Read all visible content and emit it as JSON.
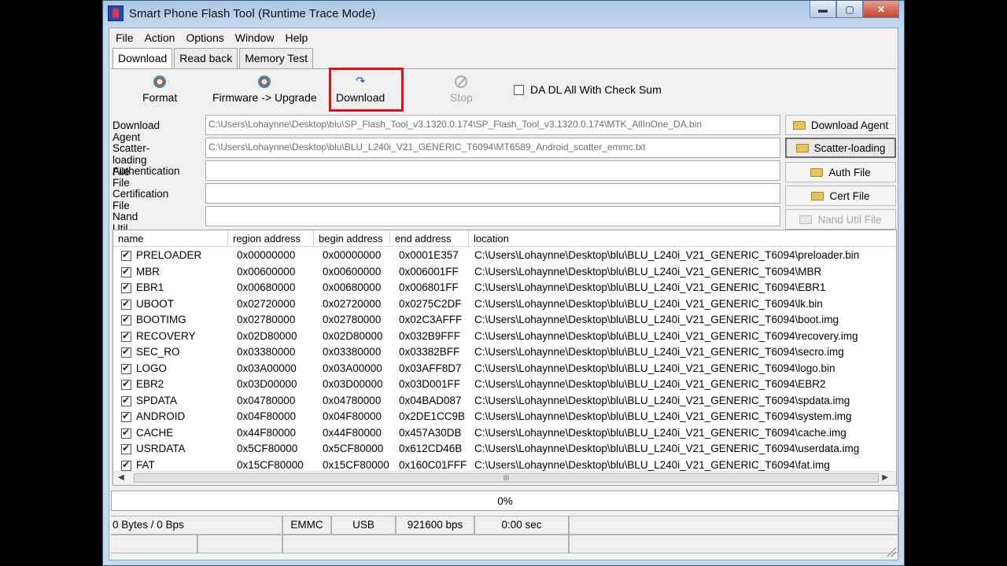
{
  "window": {
    "title": "Smart Phone Flash Tool (Runtime Trace Mode)",
    "min": "▬",
    "max": "▢",
    "close": "✕"
  },
  "menu": [
    "File",
    "Action",
    "Options",
    "Window",
    "Help"
  ],
  "tabs": [
    "Download",
    "Read back",
    "Memory Test"
  ],
  "toolbar": {
    "format": "Format",
    "firmware": "Firmware -> Upgrade",
    "download": "Download",
    "stop": "Stop",
    "checksum": "DA DL All With Check Sum"
  },
  "fields": {
    "download_agent": {
      "label": "Download Agent",
      "value": "C:\\Users\\Lohaynne\\Desktop\\blu\\SP_Flash_Tool_v3.1320.0.174\\SP_Flash_Tool_v3.1320.0.174\\MTK_AllInOne_DA.bin",
      "button": "Download Agent"
    },
    "scatter": {
      "label": "Scatter-loading File",
      "value": "C:\\Users\\Lohaynne\\Desktop\\blu\\BLU_L240i_V21_GENERIC_T6094\\MT6589_Android_scatter_emmc.txt",
      "button": "Scatter-loading"
    },
    "auth": {
      "label": "Authentication File",
      "value": "",
      "button": "Auth File"
    },
    "cert": {
      "label": "Certification File",
      "value": "",
      "button": "Cert File"
    },
    "nand": {
      "label": "Nand Util File",
      "value": "",
      "button": "Nand Util File"
    }
  },
  "table": {
    "headers": [
      "name",
      "region address",
      "begin address",
      "end address",
      "location"
    ],
    "rows": [
      [
        "PRELOADER",
        "0x00000000",
        "0x00000000",
        "0x0001E357",
        "C:\\Users\\Lohaynne\\Desktop\\blu\\BLU_L240i_V21_GENERIC_T6094\\preloader.bin"
      ],
      [
        "MBR",
        "0x00600000",
        "0x00600000",
        "0x006001FF",
        "C:\\Users\\Lohaynne\\Desktop\\blu\\BLU_L240i_V21_GENERIC_T6094\\MBR"
      ],
      [
        "EBR1",
        "0x00680000",
        "0x00680000",
        "0x006801FF",
        "C:\\Users\\Lohaynne\\Desktop\\blu\\BLU_L240i_V21_GENERIC_T6094\\EBR1"
      ],
      [
        "UBOOT",
        "0x02720000",
        "0x02720000",
        "0x0275C2DF",
        "C:\\Users\\Lohaynne\\Desktop\\blu\\BLU_L240i_V21_GENERIC_T6094\\lk.bin"
      ],
      [
        "BOOTIMG",
        "0x02780000",
        "0x02780000",
        "0x02C3AFFF",
        "C:\\Users\\Lohaynne\\Desktop\\blu\\BLU_L240i_V21_GENERIC_T6094\\boot.img"
      ],
      [
        "RECOVERY",
        "0x02D80000",
        "0x02D80000",
        "0x032B9FFF",
        "C:\\Users\\Lohaynne\\Desktop\\blu\\BLU_L240i_V21_GENERIC_T6094\\recovery.img"
      ],
      [
        "SEC_RO",
        "0x03380000",
        "0x03380000",
        "0x03382BFF",
        "C:\\Users\\Lohaynne\\Desktop\\blu\\BLU_L240i_V21_GENERIC_T6094\\secro.img"
      ],
      [
        "LOGO",
        "0x03A00000",
        "0x03A00000",
        "0x03AFF8D7",
        "C:\\Users\\Lohaynne\\Desktop\\blu\\BLU_L240i_V21_GENERIC_T6094\\logo.bin"
      ],
      [
        "EBR2",
        "0x03D00000",
        "0x03D00000",
        "0x03D001FF",
        "C:\\Users\\Lohaynne\\Desktop\\blu\\BLU_L240i_V21_GENERIC_T6094\\EBR2"
      ],
      [
        "SPDATA",
        "0x04780000",
        "0x04780000",
        "0x04BAD087",
        "C:\\Users\\Lohaynne\\Desktop\\blu\\BLU_L240i_V21_GENERIC_T6094\\spdata.img"
      ],
      [
        "ANDROID",
        "0x04F80000",
        "0x04F80000",
        "0x2DE1CC9B",
        "C:\\Users\\Lohaynne\\Desktop\\blu\\BLU_L240i_V21_GENERIC_T6094\\system.img"
      ],
      [
        "CACHE",
        "0x44F80000",
        "0x44F80000",
        "0x457A30DB",
        "C:\\Users\\Lohaynne\\Desktop\\blu\\BLU_L240i_V21_GENERIC_T6094\\cache.img"
      ],
      [
        "USRDATA",
        "0x5CF80000",
        "0x5CF80000",
        "0x612CD46B",
        "C:\\Users\\Lohaynne\\Desktop\\blu\\BLU_L240i_V21_GENERIC_T6094\\userdata.img"
      ],
      [
        "FAT",
        "0x15CF80000",
        "0x15CF80000",
        "0x160C01FFF",
        "C:\\Users\\Lohaynne\\Desktop\\blu\\BLU_L240i_V21_GENERIC_T6094\\fat.img"
      ]
    ]
  },
  "scrollbar": {
    "left": "◀",
    "right": "▶",
    "grip": "III"
  },
  "progress": "0%",
  "status": {
    "bytes": "0 Bytes / 0 Bps",
    "storage": "EMMC",
    "port": "USB",
    "baud": "921600 bps",
    "time": "0:00 sec"
  },
  "colors": {
    "highlight": "#e01010",
    "titlebar": "#aac6e4"
  }
}
